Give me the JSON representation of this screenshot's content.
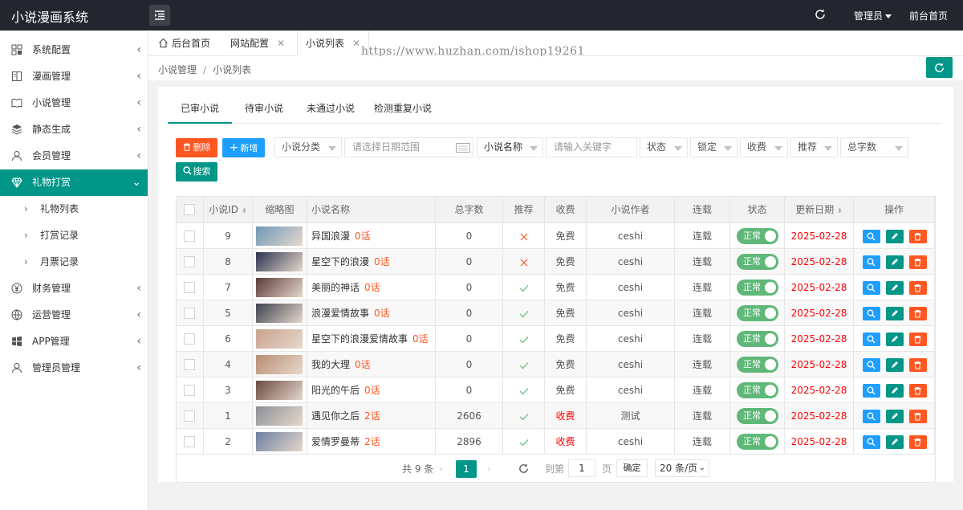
{
  "app": {
    "title": "小说漫画系统"
  },
  "topbar": {
    "admin_label": "管理员",
    "front_link": "前台首页"
  },
  "sidebar": {
    "items": [
      {
        "label": "系统配置",
        "icon": "grid-icon"
      },
      {
        "label": "漫画管理",
        "icon": "book-icon"
      },
      {
        "label": "小说管理",
        "icon": "open-book-icon"
      },
      {
        "label": "静态生成",
        "icon": "layers-icon"
      },
      {
        "label": "会员管理",
        "icon": "user-icon"
      },
      {
        "label": "礼物打赏",
        "icon": "diamond-icon",
        "active": true
      },
      {
        "label": "财务管理",
        "icon": "yen-icon"
      },
      {
        "label": "运营管理",
        "icon": "globe-icon"
      },
      {
        "label": "APP管理",
        "icon": "windows-icon"
      },
      {
        "label": "管理员管理",
        "icon": "person-icon"
      }
    ],
    "sub_items": [
      "礼物列表",
      "打赏记录",
      "月票记录"
    ]
  },
  "tabs": [
    {
      "label": "后台首页"
    },
    {
      "label": "网站配置"
    },
    {
      "label": "小说列表"
    }
  ],
  "watermark": "https://www.huzhan.com/ishop19261",
  "breadcrumb": {
    "parent": "小说管理",
    "sep": "/",
    "current": "小说列表"
  },
  "status_tabs": [
    "已审小说",
    "待审小说",
    "未通过小说",
    "检测重复小说"
  ],
  "toolbar": {
    "delete_label": "删除",
    "add_label": "新增",
    "category_placeholder": "小说分类",
    "date_placeholder": "请选择日期范围",
    "field_select": "小说名称",
    "keyword_placeholder": "请输入关键字",
    "status_select": "状态",
    "lock_select": "锁定",
    "charge_select": "收费",
    "recommend_select": "推荐",
    "words_select": "总字数",
    "search_label": "搜索"
  },
  "table": {
    "columns": [
      "小说ID",
      "缩略图",
      "小说名称",
      "总字数",
      "推荐",
      "收费",
      "小说作者",
      "连载",
      "状态",
      "更新日期",
      "操作"
    ],
    "rows": [
      {
        "id": "9",
        "name": "异国浪漫",
        "chapters": "0话",
        "words": "0",
        "recommend": "no",
        "charge": "免费",
        "author": "ceshi",
        "serial": "连载",
        "status": "正常",
        "date": "2025-02-28",
        "thumb_color": "#6f98b8"
      },
      {
        "id": "8",
        "name": "星空下的浪漫",
        "chapters": "0话",
        "words": "0",
        "recommend": "no",
        "charge": "免费",
        "author": "ceshi",
        "serial": "连载",
        "status": "正常",
        "date": "2025-02-28",
        "thumb_color": "#2b3350"
      },
      {
        "id": "7",
        "name": "美丽的神话",
        "chapters": "0话",
        "words": "0",
        "recommend": "yes",
        "charge": "免费",
        "author": "ceshi",
        "serial": "连载",
        "status": "正常",
        "date": "2025-02-28",
        "thumb_color": "#5a3b36"
      },
      {
        "id": "5",
        "name": "浪漫爱情故事",
        "chapters": "0话",
        "words": "0",
        "recommend": "yes",
        "charge": "免费",
        "author": "ceshi",
        "serial": "连载",
        "status": "正常",
        "date": "2025-02-28",
        "thumb_color": "#3d4350"
      },
      {
        "id": "6",
        "name": "星空下的浪漫爱情故事",
        "chapters": "0话",
        "words": "0",
        "recommend": "yes",
        "charge": "免费",
        "author": "ceshi",
        "serial": "连载",
        "status": "正常",
        "date": "2025-02-28",
        "thumb_color": "#c9a28e"
      },
      {
        "id": "4",
        "name": "我的大理",
        "chapters": "0话",
        "words": "0",
        "recommend": "yes",
        "charge": "免费",
        "author": "ceshi",
        "serial": "连载",
        "status": "正常",
        "date": "2025-02-28",
        "thumb_color": "#b98e72"
      },
      {
        "id": "3",
        "name": "阳光的午后",
        "chapters": "0话",
        "words": "0",
        "recommend": "yes",
        "charge": "免费",
        "author": "ceshi",
        "serial": "连载",
        "status": "正常",
        "date": "2025-02-28",
        "thumb_color": "#6a4a3e"
      },
      {
        "id": "1",
        "name": "遇见你之后",
        "chapters": "2话",
        "words": "2606",
        "recommend": "yes",
        "charge": "收费",
        "author": "测试",
        "serial": "连载",
        "status": "正常",
        "date": "2025-02-28",
        "thumb_color": "#8c8f96"
      },
      {
        "id": "2",
        "name": "爱情罗曼蒂",
        "chapters": "2话",
        "words": "2896",
        "recommend": "yes",
        "charge": "收费",
        "author": "ceshi",
        "serial": "连载",
        "status": "正常",
        "date": "2025-02-28",
        "thumb_color": "#6c7fa0"
      }
    ]
  },
  "pager": {
    "total": "共 9 条",
    "current_page": "1",
    "goto_label": "到第",
    "goto_value": "1",
    "page_unit": "页",
    "confirm_label": "确定",
    "page_size": "20 条/页"
  },
  "colors": {
    "accent": "#009688",
    "danger": "#ff5722",
    "info": "#1e9fff",
    "switch_on": "#5fb878",
    "date_red": "#ff0000"
  }
}
